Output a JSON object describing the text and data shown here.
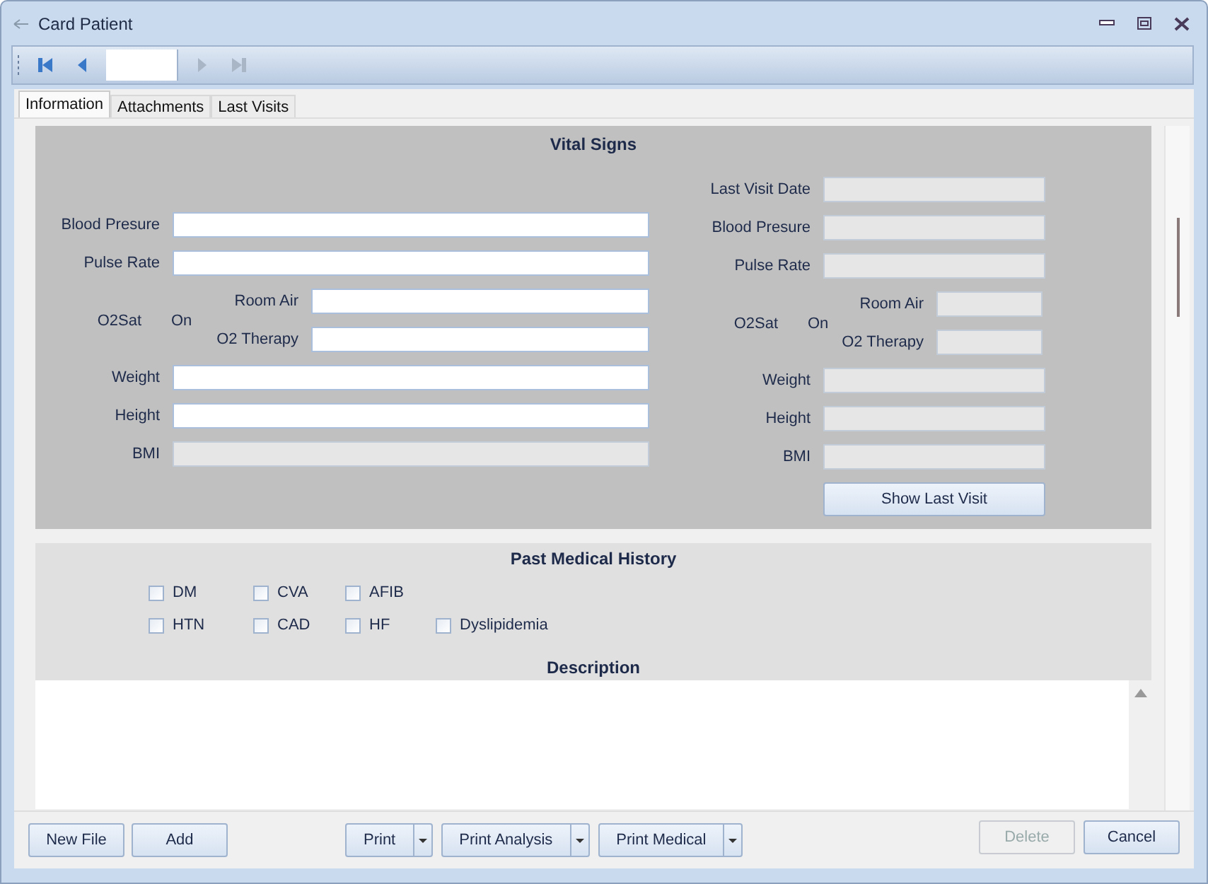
{
  "window": {
    "title": "Card Patient"
  },
  "navigator": {
    "buttons": [
      {
        "kind": "first",
        "disabled": false
      },
      {
        "kind": "prev",
        "disabled": false
      },
      {
        "kind": "next",
        "disabled": true
      },
      {
        "kind": "last",
        "disabled": true
      }
    ]
  },
  "tabs": [
    {
      "label": "Information",
      "selected": true
    },
    {
      "label": "Attachments",
      "selected": false
    },
    {
      "label": "Last Visits",
      "selected": false
    }
  ],
  "vital_signs": {
    "title": "Vital Signs",
    "current": [
      {
        "kind": "text",
        "label": "Blood Presure",
        "readonly": false
      },
      {
        "kind": "text",
        "label": "Pulse Rate",
        "readonly": false
      },
      {
        "kind": "o2sat",
        "label": "O2Sat",
        "on_label": "On",
        "options": [
          {
            "label": "Room Air",
            "readonly": false
          },
          {
            "label": "O2 Therapy",
            "readonly": false
          }
        ]
      },
      {
        "kind": "text",
        "label": "Weight",
        "readonly": false
      },
      {
        "kind": "text",
        "label": "Height",
        "readonly": false
      },
      {
        "kind": "text",
        "label": "BMI",
        "readonly": true
      }
    ],
    "last_visit": [
      {
        "kind": "text",
        "label": "Last Visit Date",
        "readonly": true
      },
      {
        "kind": "text",
        "label": "Blood Presure",
        "readonly": true
      },
      {
        "kind": "text",
        "label": "Pulse Rate",
        "readonly": true
      },
      {
        "kind": "o2sat",
        "label": "O2Sat",
        "on_label": "On",
        "options": [
          {
            "label": "Room Air",
            "readonly": true
          },
          {
            "label": "O2 Therapy",
            "readonly": true
          }
        ]
      },
      {
        "kind": "text",
        "label": "Weight",
        "readonly": true
      },
      {
        "kind": "text",
        "label": "Height",
        "readonly": true
      },
      {
        "kind": "text",
        "label": "BMI",
        "readonly": true
      }
    ],
    "button": "Show Last Visit"
  },
  "past_medical_history": {
    "title": "Past Medical History",
    "rows": [
      [
        {
          "label": "DM",
          "checked": false
        },
        {
          "label": "CVA",
          "checked": false
        },
        {
          "label": "AFIB",
          "checked": false
        }
      ],
      [
        {
          "label": "HTN",
          "checked": false
        },
        {
          "label": "CAD",
          "checked": false
        },
        {
          "label": "HF",
          "checked": false
        },
        {
          "label": "Dyslipidemia",
          "checked": false
        }
      ]
    ],
    "description_title": "Description"
  },
  "footer": {
    "left": [
      {
        "kind": "button",
        "label": "New File",
        "disabled": false
      },
      {
        "kind": "button",
        "label": "Add",
        "disabled": false
      }
    ],
    "center": [
      {
        "kind": "split",
        "label": "Print",
        "disabled": false
      },
      {
        "kind": "split",
        "label": "Print Analysis",
        "disabled": false
      },
      {
        "kind": "split",
        "label": "Print Medical",
        "disabled": false
      }
    ],
    "right": [
      {
        "kind": "button",
        "label": "Delete",
        "disabled": true
      },
      {
        "kind": "button",
        "label": "Cancel",
        "disabled": false
      }
    ]
  }
}
